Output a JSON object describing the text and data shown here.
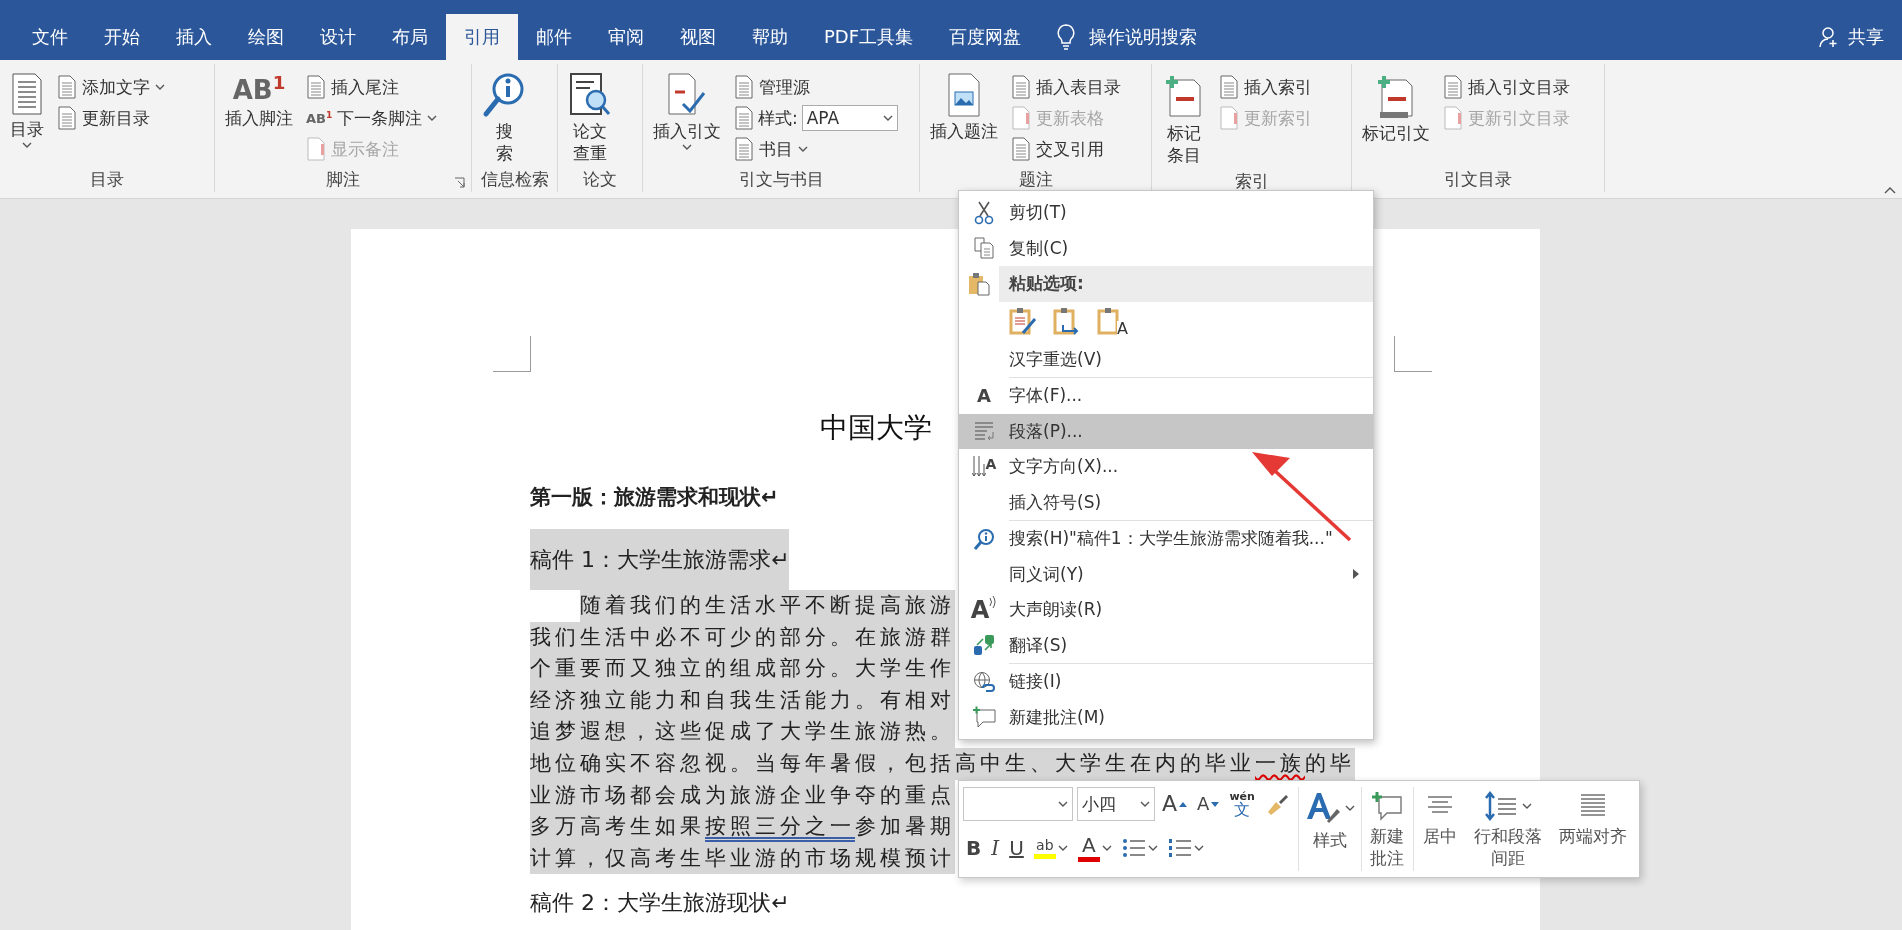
{
  "tabs": [
    {
      "label": "文件",
      "selected": false
    },
    {
      "label": "开始",
      "selected": false
    },
    {
      "label": "插入",
      "selected": false
    },
    {
      "label": "绘图",
      "selected": false
    },
    {
      "label": "设计",
      "selected": false
    },
    {
      "label": "布局",
      "selected": false
    },
    {
      "label": "引用",
      "selected": true
    },
    {
      "label": "邮件",
      "selected": false
    },
    {
      "label": "审阅",
      "selected": false
    },
    {
      "label": "视图",
      "selected": false
    },
    {
      "label": "帮助",
      "selected": false
    },
    {
      "label": "PDF工具集",
      "selected": false
    },
    {
      "label": "百度网盘",
      "selected": false
    }
  ],
  "tell_me": "操作说明搜索",
  "share": "共享",
  "ribbon": {
    "groups": [
      {
        "label": "目录",
        "launcher": false,
        "items": [
          {
            "kind": "large",
            "label": "目录",
            "disabled": false,
            "dropdown": true
          },
          {
            "kind": "small",
            "label": "添加文字",
            "disabled": false,
            "dropdown": true
          },
          {
            "kind": "small",
            "label": "更新目录",
            "disabled": false,
            "dropdown": false
          }
        ]
      },
      {
        "label": "脚注",
        "launcher": true,
        "items": [
          {
            "kind": "large",
            "label": "插入脚注",
            "glyph": "AB$^{1}$",
            "disabled": false,
            "dropdown": false
          },
          {
            "kind": "small",
            "label": "插入尾注",
            "disabled": false,
            "dropdown": false
          },
          {
            "kind": "small",
            "label": "下一条脚注",
            "glyph": "AB$^{1}$",
            "disabled": false,
            "dropdown": true
          },
          {
            "kind": "small",
            "label": "显示备注",
            "disabled": true,
            "dropdown": false
          }
        ]
      },
      {
        "label": "信息检索",
        "launcher": false,
        "items": [
          {
            "kind": "stacked",
            "label": "搜索",
            "disabled": false,
            "dropdown": false
          }
        ]
      },
      {
        "label": "论文",
        "launcher": false,
        "items": [
          {
            "kind": "stacked",
            "label": "论文查重",
            "disabled": false,
            "dropdown": false
          }
        ]
      },
      {
        "label": "引文与书目",
        "launcher": false,
        "items": [
          {
            "kind": "large",
            "label": "插入引文",
            "disabled": false,
            "dropdown": true
          },
          {
            "kind": "small",
            "label": "管理源",
            "disabled": false,
            "dropdown": false
          },
          {
            "kind": "select",
            "label": "样式:",
            "value": "APA",
            "disabled": false,
            "dropdown": true
          },
          {
            "kind": "small",
            "label": "书目",
            "disabled": false,
            "dropdown": true
          }
        ]
      },
      {
        "label": "题注",
        "launcher": false,
        "items": [
          {
            "kind": "large",
            "label": "插入题注",
            "disabled": false,
            "dropdown": false
          },
          {
            "kind": "small",
            "label": "插入表目录",
            "disabled": false,
            "dropdown": false
          },
          {
            "kind": "small",
            "label": "更新表格",
            "disabled": true,
            "dropdown": false
          },
          {
            "kind": "small",
            "label": "交叉引用",
            "disabled": false,
            "dropdown": false
          }
        ]
      },
      {
        "label": "索引",
        "launcher": false,
        "items": [
          {
            "kind": "stacked",
            "label": "标记条目",
            "disabled": false,
            "dropdown": false
          },
          {
            "kind": "small",
            "label": "插入索引",
            "disabled": false,
            "dropdown": false
          },
          {
            "kind": "small",
            "label": "更新索引",
            "disabled": true,
            "dropdown": false
          }
        ]
      },
      {
        "label": "引文目录",
        "launcher": false,
        "items": [
          {
            "kind": "large",
            "label": "标记引文",
            "disabled": false,
            "dropdown": false
          },
          {
            "kind": "small",
            "label": "插入引文目录",
            "disabled": false,
            "dropdown": false
          },
          {
            "kind": "small",
            "label": "更新引文目录",
            "disabled": true,
            "dropdown": false
          }
        ]
      }
    ]
  },
  "document": {
    "title": "中国大学",
    "heading": "第一版：旅游需求和现状↵",
    "draft1": {
      "text": "稿件 1：大学生旅游需求↵",
      "highlighted": true
    },
    "body": {
      "highlighted": true,
      "lines": [
        [
          {
            "text": "随着我们的生活水平不断提高旅游"
          }
        ],
        [
          {
            "text": "我们生活中必不可少的部分。在旅游群"
          }
        ],
        [
          {
            "text": "个重要而又独立的组成部分。大学生作"
          }
        ],
        [
          {
            "text": "经济独立能力和自我生活能力。有相对"
          }
        ],
        [
          {
            "text": "追梦遐想，这些促成了大学生旅游热。"
          }
        ],
        [
          {
            "text": "地位确实不容忽视。当每年暑假，包括高中生、大学生在内的毕业"
          },
          {
            "text": "一族",
            "kind": "spelling"
          },
          {
            "text": "的毕"
          }
        ],
        [
          {
            "text": "业游市场都会成为旅游企业争夺的重点"
          }
        ],
        [
          {
            "text": "多万高考生如果"
          },
          {
            "text": "按照三分之一",
            "kind": "grammar"
          },
          {
            "text": "参加暑期"
          }
        ],
        [
          {
            "text": "计算，仅高考生毕业游的市场规模预计"
          }
        ]
      ]
    },
    "draft2": {
      "text": "稿件 2：大学生旅游现状↵",
      "highlighted": false
    }
  },
  "context_menu": {
    "items": [
      {
        "kind": "item",
        "label": "剪切(T)",
        "selected": false,
        "submenu": false
      },
      {
        "kind": "item",
        "label": "复制(C)",
        "selected": false,
        "submenu": false
      },
      {
        "kind": "header",
        "label": "粘贴选项:"
      },
      {
        "kind": "paste-options",
        "options": [
          {
            "kind": "keep-source"
          },
          {
            "kind": "merge"
          },
          {
            "kind": "text-only",
            "glyph": "A"
          }
        ]
      },
      {
        "kind": "item",
        "label": "汉字重选(V)",
        "selected": false,
        "submenu": false
      },
      {
        "kind": "separator"
      },
      {
        "kind": "item",
        "label": "字体(F)...",
        "glyph": "A",
        "selected": false,
        "submenu": false
      },
      {
        "kind": "item",
        "label": "段落(P)...",
        "selected": true,
        "submenu": false
      },
      {
        "kind": "item",
        "label": "文字方向(X)...",
        "glyph": "A",
        "selected": false,
        "submenu": false
      },
      {
        "kind": "item",
        "label": "插入符号(S)",
        "selected": false,
        "submenu": false
      },
      {
        "kind": "separator"
      },
      {
        "kind": "item",
        "label": "搜索(H)\"稿件1：大学生旅游需求随着我...\"",
        "selected": false,
        "submenu": false
      },
      {
        "kind": "item",
        "label": "同义词(Y)",
        "selected": false,
        "submenu": true
      },
      {
        "kind": "item",
        "label": "大声朗读(R)",
        "glyph": "A",
        "selected": false,
        "submenu": false
      },
      {
        "kind": "item",
        "label": "翻译(S)",
        "selected": false,
        "submenu": false
      },
      {
        "kind": "separator"
      },
      {
        "kind": "item",
        "label": "链接(I)",
        "selected": false,
        "submenu": false
      },
      {
        "kind": "item",
        "label": "新建批注(M)",
        "selected": false,
        "submenu": false
      }
    ]
  },
  "mini_toolbar": {
    "size_value": "小四",
    "top": [
      {
        "kind": "grow-font",
        "glyph": "A"
      },
      {
        "kind": "shrink-font",
        "glyph": "A"
      },
      {
        "kind": "phonetic",
        "ruby": "wén",
        "glyph": "文"
      },
      {
        "kind": "painter"
      }
    ],
    "bottom": [
      {
        "kind": "bold",
        "glyph": "B",
        "dropdown": false
      },
      {
        "kind": "italic",
        "glyph": "I",
        "dropdown": false
      },
      {
        "kind": "underline",
        "glyph": "U",
        "dropdown": false
      },
      {
        "kind": "highlight",
        "glyph": "ab",
        "color": "#ffff00",
        "dropdown": true
      },
      {
        "kind": "font-color",
        "glyph": "A",
        "color": "#e00000",
        "dropdown": true
      },
      {
        "kind": "bullets",
        "dropdown": true
      },
      {
        "kind": "numbering",
        "dropdown": true
      }
    ],
    "buttons": [
      {
        "kind": "styles",
        "label": "样式",
        "dropdown": true
      },
      {
        "kind": "comment",
        "label": "新建批注",
        "dropdown": false
      },
      {
        "kind": "center",
        "label": "居中",
        "dropdown": false
      },
      {
        "kind": "spacing",
        "label": "行和段落间距",
        "dropdown": true
      },
      {
        "kind": "justify",
        "label": "两端对齐",
        "dropdown": false
      }
    ]
  }
}
